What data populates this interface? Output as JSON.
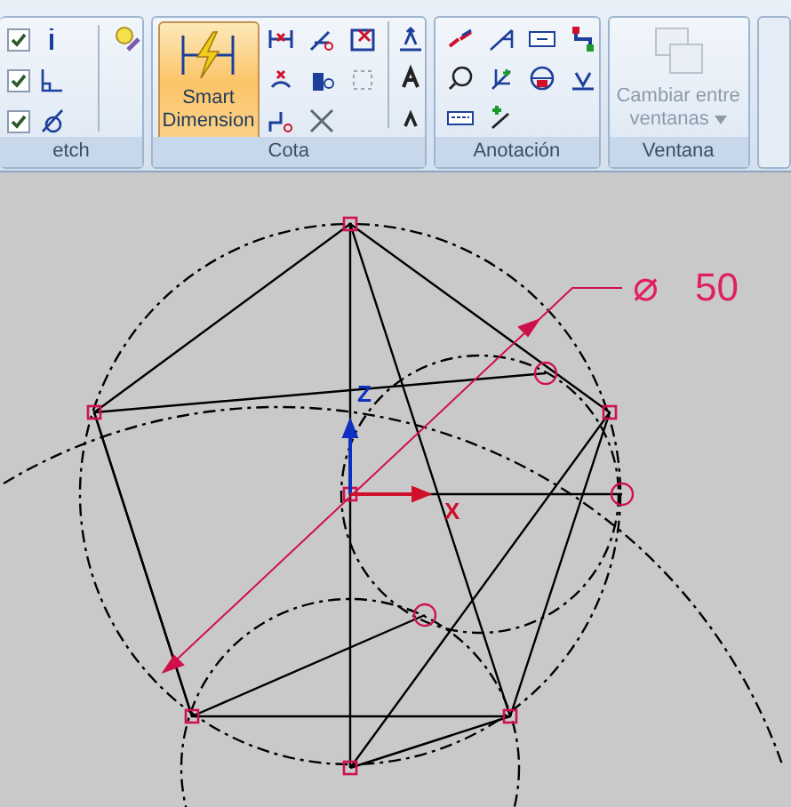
{
  "ribbon": {
    "groups": [
      {
        "kind": "sketch",
        "label": "etch",
        "checkboxes": [
          {
            "checked": true
          },
          {
            "checked": true
          },
          {
            "checked": true
          }
        ]
      },
      {
        "kind": "dimension",
        "label": "Cota",
        "main_button": {
          "label": "Smart Dimension",
          "selected": true
        }
      },
      {
        "kind": "annotation",
        "label": "Anotación"
      },
      {
        "kind": "window",
        "label": "Ventana",
        "button": {
          "label": "Cambiar entre ventanas",
          "disabled": true
        }
      }
    ]
  },
  "canvas": {
    "axis_labels": [
      "Z",
      "X"
    ],
    "dimension": {
      "symbol": "⌀",
      "value": "50"
    }
  }
}
